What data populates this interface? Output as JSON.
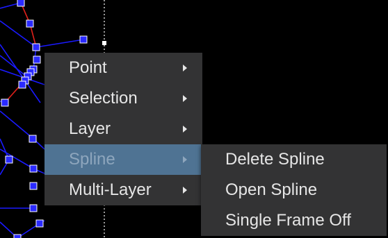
{
  "context_menu": {
    "items": [
      {
        "label": "Point",
        "has_submenu": true,
        "highlighted": false
      },
      {
        "label": "Selection",
        "has_submenu": true,
        "highlighted": false
      },
      {
        "label": "Layer",
        "has_submenu": true,
        "highlighted": false
      },
      {
        "label": "Spline",
        "has_submenu": true,
        "highlighted": true
      },
      {
        "label": "Multi-Layer",
        "has_submenu": true,
        "highlighted": false
      }
    ]
  },
  "spline_submenu": {
    "items": [
      {
        "label": "Delete Spline"
      },
      {
        "label": "Open Spline"
      },
      {
        "label": "Single Frame Off"
      }
    ]
  },
  "colors": {
    "background": "#000000",
    "menu_bg": "#333334",
    "menu_text": "#e6e6e6",
    "highlight_bg": "#4f7393",
    "highlight_text": "#8ea6bd",
    "spline_line": "#1a1aff",
    "spline_point": "#2a2aff",
    "selected_segment": "#e0201a",
    "guide_line": "#ffffff"
  },
  "icons": {
    "submenu_arrow": "chevron-right-icon"
  }
}
